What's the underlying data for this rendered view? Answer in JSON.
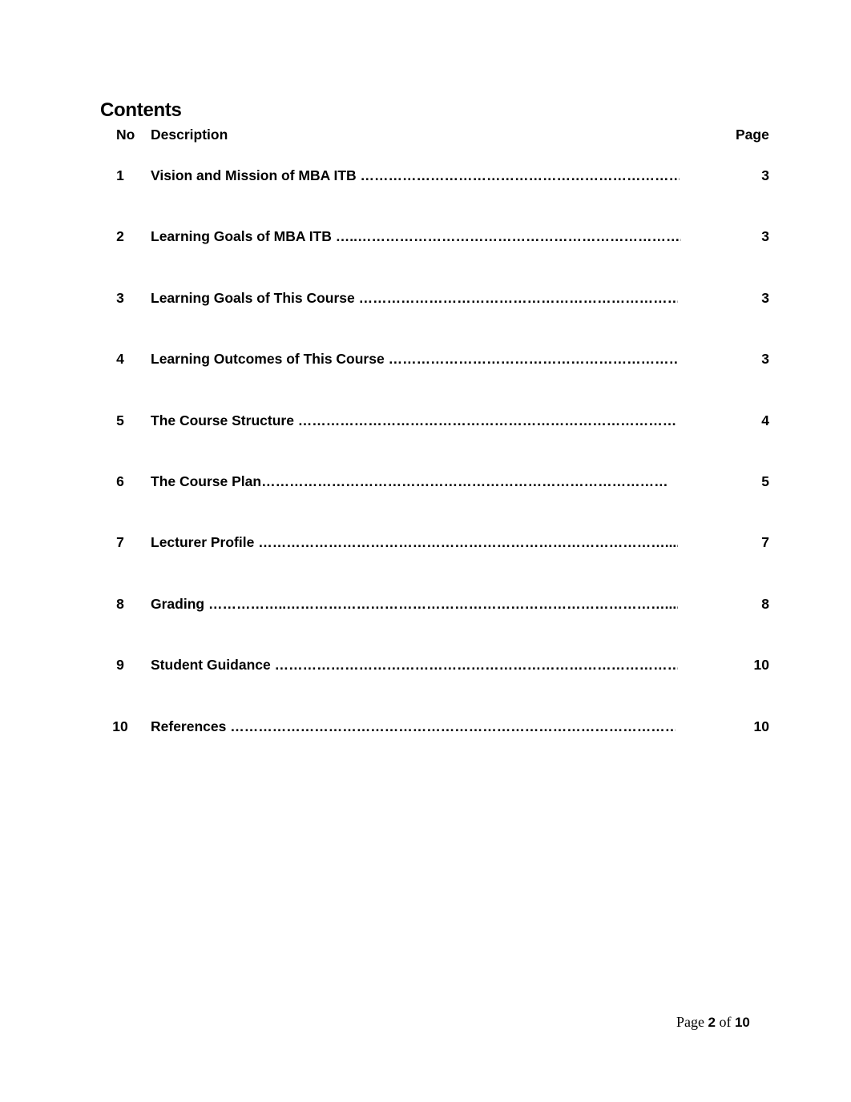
{
  "title": "Contents",
  "headers": {
    "no": "No",
    "description": "Description",
    "page": "Page"
  },
  "entries": [
    {
      "no": "1",
      "text": "Vision and Mission of MBA ITB ……………………………………………………………........",
      "page": "3"
    },
    {
      "no": "2",
      "text": "Learning Goals of MBA ITB …..……………………………………………………………..........",
      "page": "3"
    },
    {
      "no": "3",
      "text": "Learning Goals of This Course ………………………………………………………………........",
      "page": "3"
    },
    {
      "no": "4",
      "text": "Learning Outcomes of This Course ……………………………………………………….......",
      "page": "3"
    },
    {
      "no": "5",
      "text": "The Course Structure ………………………………………………………………………….........",
      "page": "4"
    },
    {
      "no": "6",
      "text": "The Course Plan……………………………………………………………………………...............",
      "page": "5"
    },
    {
      "no": "7",
      "text": "Lecturer Profile  …………………………………………………………………………….........",
      "page": "7"
    },
    {
      "no": "8",
      "text": "Grading ……………..……………………………………………………………………….............",
      "page": "8"
    },
    {
      "no": "9",
      "text": "Student Guidance ……………………………………………………………………………........",
      "page": "10"
    },
    {
      "no": "10",
      "text": "References ………………………………………………………………………………………........",
      "page": "10"
    }
  ],
  "footer": {
    "prefix": "Page",
    "current": "2",
    "of": "of",
    "total": "10"
  }
}
